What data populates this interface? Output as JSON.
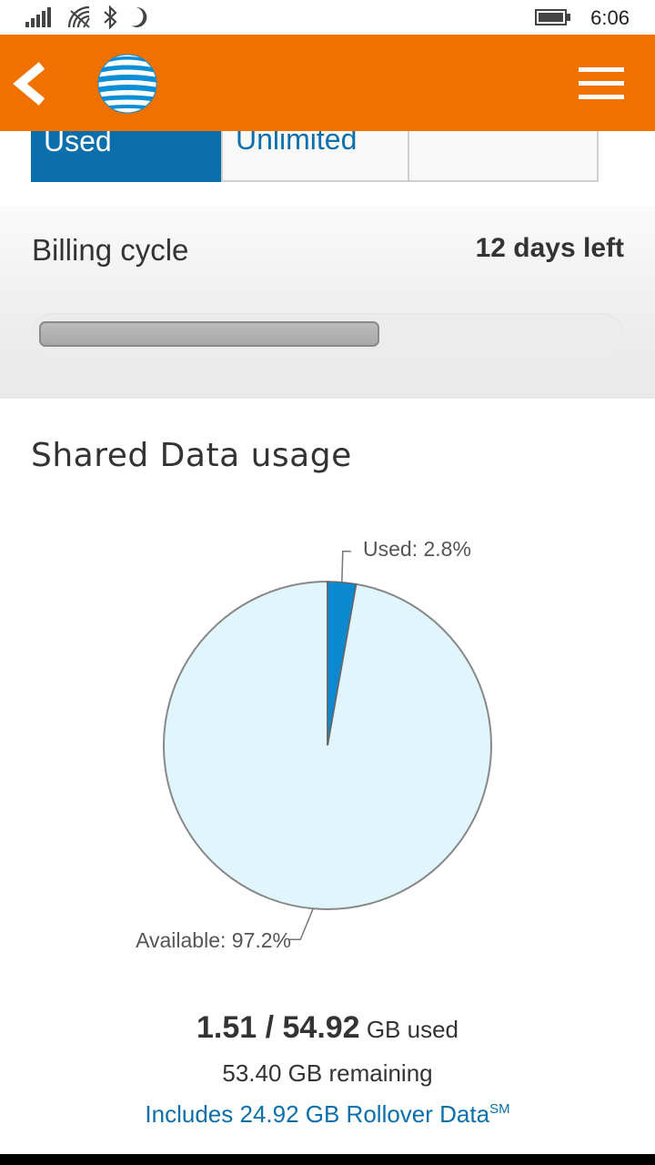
{
  "status_bar": {
    "time": "6:06",
    "icons": [
      "signal-icon",
      "wifi-icon",
      "bluetooth-icon",
      "quiet-hours-icon",
      "battery-icon"
    ]
  },
  "app_bar": {
    "back_icon": "chevron-left-icon",
    "logo": "att-globe-logo",
    "menu_icon": "hamburger-menu-icon",
    "color": "#f07000"
  },
  "tabs": [
    {
      "label": "Used",
      "selected": true
    },
    {
      "label": "Unlimited",
      "selected": false
    },
    {
      "label": "",
      "selected": false
    }
  ],
  "billing": {
    "title": "Billing cycle",
    "days_left": "12 days left",
    "progress_fraction": 0.59
  },
  "usage": {
    "title": "Shared Data usage",
    "used_gb": "1.51 / 54.92",
    "used_suffix": "GB used",
    "remaining": "53.40 GB remaining",
    "rollover": "Includes 24.92 GB Rollover Data",
    "rollover_mark": "SM"
  },
  "chart_data": {
    "type": "pie",
    "slices": [
      {
        "label": "Used: 2.8%",
        "value": 2.8,
        "color": "#0a88d0"
      },
      {
        "label": "Available: 97.2%",
        "value": 97.2,
        "color": "#e1f5fc"
      }
    ]
  },
  "colors": {
    "accent_blue": "#0a6faa",
    "orange": "#f07000"
  }
}
